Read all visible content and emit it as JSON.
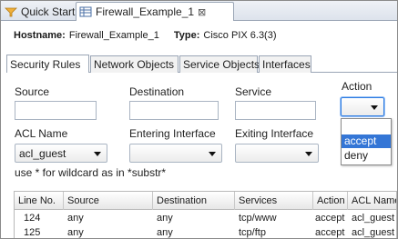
{
  "editor_tabs": [
    {
      "label": "Quick Start"
    },
    {
      "label": "Firewall_Example_1",
      "close": "⊠"
    }
  ],
  "header": {
    "hostname_label": "Hostname:",
    "hostname_value": "Firewall_Example_1",
    "type_label": "Type:",
    "type_value": "Cisco PIX 6.3(3)"
  },
  "tabs": [
    "Security Rules",
    "Network Objects",
    "Service Objects",
    "Interfaces"
  ],
  "filters": {
    "source_label": "Source",
    "destination_label": "Destination",
    "service_label": "Service",
    "action_label": "Action",
    "acl_name_label": "ACL Name",
    "acl_name_value": "acl_guest",
    "entering_label": "Entering Interface",
    "exiting_label": "Exiting Interface",
    "hint": "use * for wildcard as in *substr*"
  },
  "action_options": [
    "accept",
    "deny"
  ],
  "table": {
    "columns": [
      "Line No.",
      "Source",
      "Destination",
      "Services",
      "Action",
      "ACL Name"
    ],
    "rows": [
      [
        "124",
        "any",
        "any",
        "tcp/www",
        "accept",
        "acl_guest"
      ],
      [
        "125",
        "any",
        "any",
        "tcp/ftp",
        "accept",
        "acl_guest"
      ]
    ]
  },
  "colors": {
    "accent": "#3476d6",
    "focus": "#2a7ae2"
  }
}
